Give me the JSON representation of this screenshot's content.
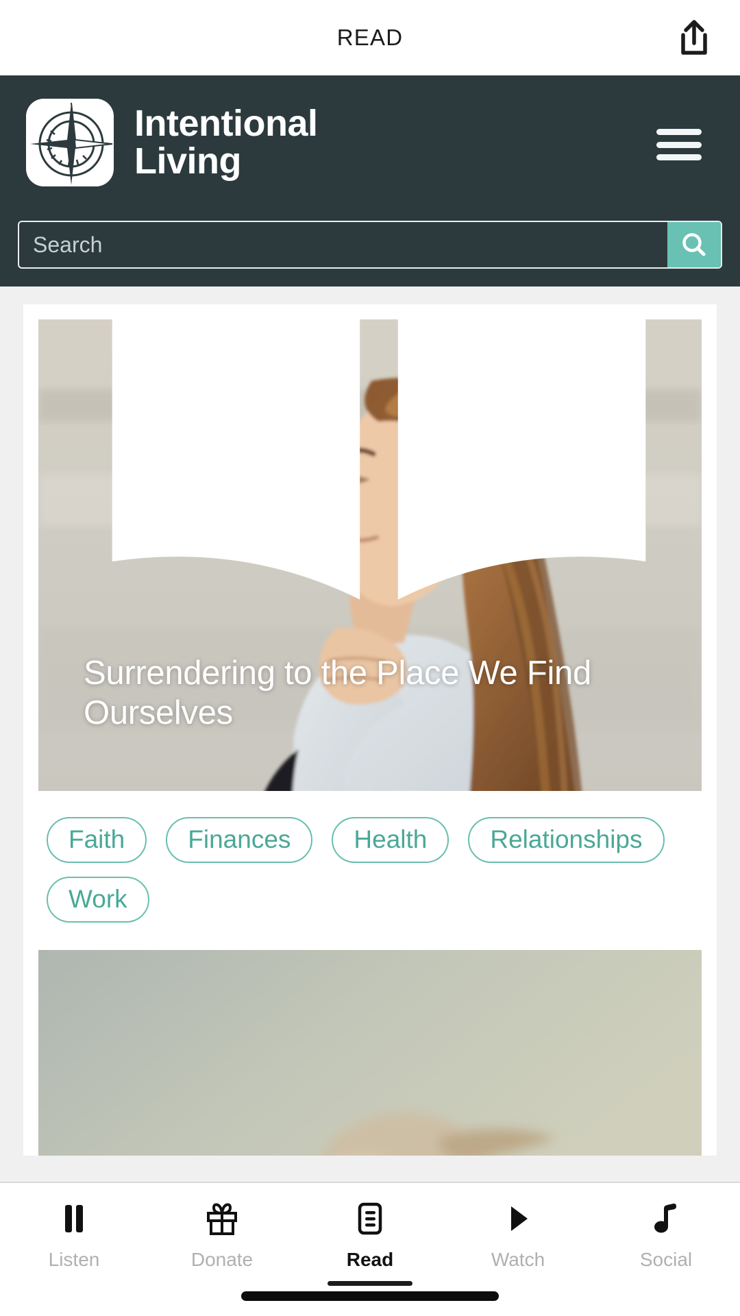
{
  "navbar": {
    "title": "READ",
    "share_icon": "share-icon"
  },
  "header": {
    "brand_line1": "Intentional",
    "brand_line2": "Living",
    "logo_icon": "compass-logo-icon",
    "menu_icon": "hamburger-menu-icon",
    "background_color": "#2c3a3e"
  },
  "search": {
    "placeholder": "Search",
    "value": "",
    "button_icon": "search-icon",
    "button_color": "#68c1b2"
  },
  "article": {
    "badge_icon": "open-book-icon",
    "title": "Surrendering to the Place We Find Ourselves",
    "image_alt": "Woman with long auburn wavy hair sitting on a beach at sunset, hands clasped under her chin, eyes closed",
    "tags": [
      {
        "label": "Faith"
      },
      {
        "label": "Finances"
      },
      {
        "label": "Health"
      },
      {
        "label": "Relationships"
      },
      {
        "label": "Work"
      }
    ],
    "tag_color": "#4aa897"
  },
  "next_article": {
    "image_alt": "Soft sage-toned photo partially visible below the fold"
  },
  "tabbar": {
    "items": [
      {
        "label": "Listen",
        "icon": "pause-icon",
        "active": false
      },
      {
        "label": "Donate",
        "icon": "gift-icon",
        "active": false
      },
      {
        "label": "Read",
        "icon": "document-icon",
        "active": true
      },
      {
        "label": "Watch",
        "icon": "play-icon",
        "active": false
      },
      {
        "label": "Social",
        "icon": "music-note-icon",
        "active": false
      }
    ],
    "active_color": "#111111",
    "inactive_color": "#b0b0b0"
  }
}
